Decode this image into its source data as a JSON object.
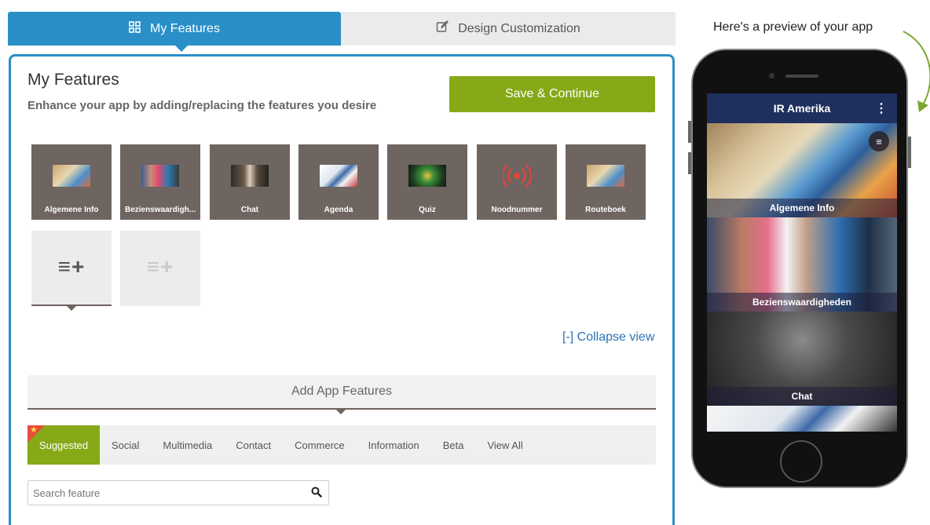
{
  "tabs": {
    "features": {
      "label": "My Features",
      "icon": "grid-icon"
    },
    "design": {
      "label": "Design Customization",
      "icon": "edit-icon"
    }
  },
  "panel": {
    "title": "My Features",
    "subtitle": "Enhance your app by adding/replacing the features you desire",
    "save_label": "Save & Continue"
  },
  "features": [
    {
      "label": "Algemene Info",
      "thumb": "map-thumbnail"
    },
    {
      "label": "Bezienswaardigh...",
      "thumb": "students-thumbnail"
    },
    {
      "label": "Chat",
      "thumb": "chat-thumbnail"
    },
    {
      "label": "Agenda",
      "thumb": "calendar-thumbnail"
    },
    {
      "label": "Quiz",
      "thumb": "quiz-thumbnail"
    },
    {
      "label": "Noodnummer",
      "thumb": "signal-icon"
    },
    {
      "label": "Routeboek",
      "thumb": "map-thumbnail"
    }
  ],
  "add_glyph": "≡+",
  "collapse_label": "[-] Collapse view",
  "add_features_label": "Add App Features",
  "categories": [
    "Suggested",
    "Social",
    "Multimedia",
    "Contact",
    "Commerce",
    "Information",
    "Beta",
    "View All"
  ],
  "search": {
    "placeholder": "Search feature",
    "icon": "search-icon"
  },
  "preview": {
    "title": "Here's a preview of your app",
    "app_title": "IR Amerika",
    "items": [
      "Algemene Info",
      "Bezienswaardigheden",
      "Chat"
    ]
  },
  "colors": {
    "accent": "#2a8fc7",
    "save": "#86a918",
    "tile": "#6e6460",
    "appbar": "#1f2f5e"
  }
}
